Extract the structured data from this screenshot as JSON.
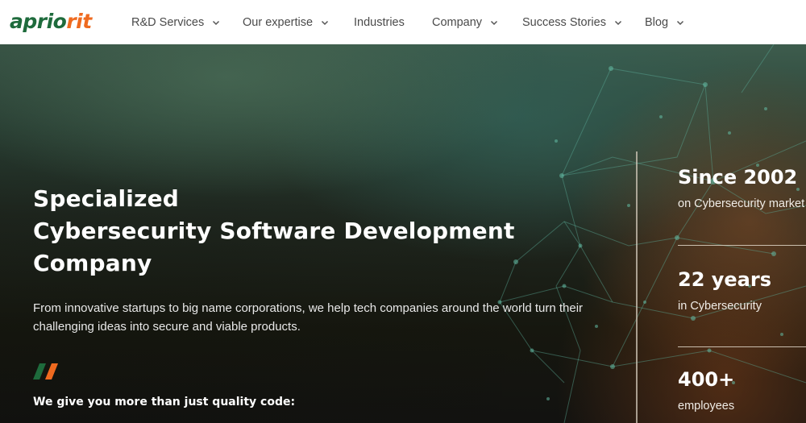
{
  "header": {
    "logo": {
      "part1": "aprio",
      "part2": "rit"
    },
    "nav": [
      {
        "label": "R&D Services",
        "has_dropdown": true,
        "icon": "chevron-down-icon"
      },
      {
        "label": "Our expertise",
        "has_dropdown": true,
        "icon": "chevron-down-icon"
      },
      {
        "label": "Industries",
        "has_dropdown": false
      },
      {
        "label": "Company",
        "has_dropdown": true,
        "icon": "chevron-down-icon"
      },
      {
        "label": "Success Stories",
        "has_dropdown": true,
        "icon": "chevron-down-icon"
      },
      {
        "label": "Blog",
        "has_dropdown": true,
        "icon": "chevron-down-icon"
      }
    ]
  },
  "hero": {
    "title_lines": [
      "Specialized",
      "Cybersecurity Software Development",
      "Company"
    ],
    "lead": "From innovative startups to big name corporations, we help tech companies around the world turn their challenging ideas into secure and viable products.",
    "decor_icon": "double-slash-icon",
    "subheading": "We give you more than just quality code:"
  },
  "stats": [
    {
      "value": "Since 2002",
      "label": "on Cybersecurity market"
    },
    {
      "value": "22 years",
      "label": "in Cybersecurity"
    },
    {
      "value": "400+",
      "label": "employees"
    }
  ],
  "colors": {
    "brand_green": "#1e6b3c",
    "brand_orange": "#ef6a1f",
    "nav_text": "#4a4a4a",
    "hero_text": "#ffffff"
  }
}
